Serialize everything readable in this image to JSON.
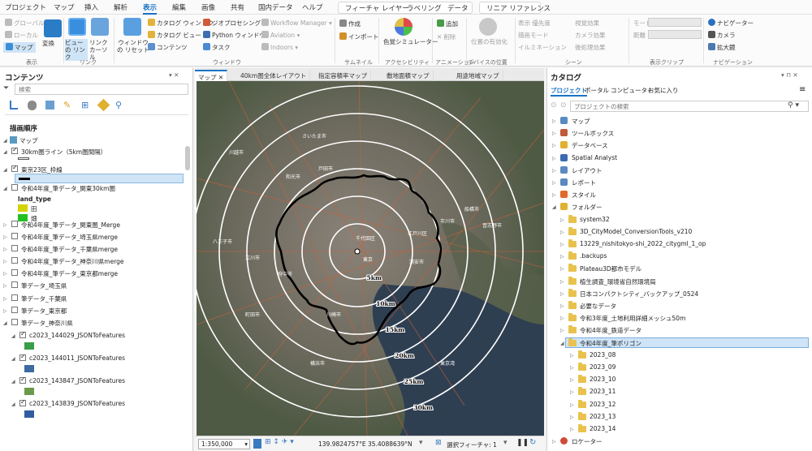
{
  "menu": {
    "tabs": [
      "プロジェクト",
      "マップ",
      "挿入",
      "解析",
      "表示",
      "編集",
      "画像",
      "共有",
      "国内データ",
      "ヘルプ"
    ],
    "active_index": 4,
    "context_tabs": [
      "フィーチャ レイヤー",
      "ラベリング",
      "データ"
    ],
    "context_tab2": "リニア リファレンス"
  },
  "ribbon": {
    "link_group": {
      "items": [
        "グローバル",
        "ローカル",
        "マップ"
      ],
      "label": "表示"
    },
    "change": "変換",
    "link": {
      "items": [
        "ビューの リンク",
        "リンク カーソル"
      ],
      "label": "リンク"
    },
    "window_reset": "ウィンドウの リセット",
    "window_items": [
      "カタログ ウィンドウ",
      "カタログ ビュー",
      "コンテンツ",
      "ジオプロセシング",
      "Python ウィンドウ",
      "タスク",
      "Workflow Manager",
      "Aviation",
      "Indoors"
    ],
    "window_label": "ウィンドウ",
    "thumbnail": {
      "items": [
        "作成",
        "インポート"
      ],
      "label": "サムネイル"
    },
    "accessibility": {
      "item": "色覚シミュレーター",
      "label": "アクセシビリティ"
    },
    "animation": {
      "items": [
        "追加",
        "削除"
      ],
      "label": "アニメーション"
    },
    "device": {
      "item": "位置の有効化",
      "label": "デバイスの位置"
    },
    "scene": {
      "items": [
        "表示 優先度",
        "描画モード",
        "イルミネーション",
        "視覚効果",
        "カメラ効果",
        "後処理効果"
      ],
      "label": "シーン"
    },
    "clip": {
      "items": [
        "モード",
        "距離"
      ],
      "label": "表示クリップ"
    },
    "navigation": {
      "items": [
        "ナビゲーター",
        "カメラ",
        "拡大鏡"
      ],
      "label": "ナビゲーション"
    }
  },
  "contents": {
    "title": "コンテンツ",
    "search_placeholder": "検索",
    "order_label": "描画順序",
    "map_root": "マップ",
    "layers": [
      {
        "label": "30km圏ライン（5km圏間隔）",
        "checked": true,
        "expanded": true
      },
      {
        "label": "東京23区_枠線",
        "checked": true,
        "expanded": true
      },
      {
        "label": "令和4年度_筆データ_関東30km圏",
        "checked": false,
        "expanded": true
      },
      {
        "label": "令和4年度_筆データ_関東圏_Merge",
        "checked": false,
        "expanded": false
      },
      {
        "label": "令和4年度_筆データ_埼玉県merge",
        "checked": false,
        "expanded": false
      },
      {
        "label": "令和4年度_筆データ_千葉県merge",
        "checked": false,
        "expanded": false
      },
      {
        "label": "令和4年度_筆データ_神奈川県merge",
        "checked": false,
        "expanded": false
      },
      {
        "label": "令和4年度_筆データ_東京都merge",
        "checked": false,
        "expanded": false
      },
      {
        "label": "筆データ_埼玉県",
        "checked": false,
        "expanded": false
      },
      {
        "label": "筆データ_千葉県",
        "checked": false,
        "expanded": false
      },
      {
        "label": "筆データ_東京都",
        "checked": false,
        "expanded": false
      },
      {
        "label": "筆データ_神奈川県",
        "checked": false,
        "expanded": true
      },
      {
        "label": "c2023_144029_JSONToFeatures",
        "checked": true,
        "expanded": true
      },
      {
        "label": "c2023_144011_JSONToFeatures",
        "checked": true,
        "expanded": true
      },
      {
        "label": "c2023_143847_JSONToFeatures",
        "checked": true,
        "expanded": true
      },
      {
        "label": "c2023_143839_JSONToFeatures",
        "checked": true,
        "expanded": true
      }
    ],
    "land_type": {
      "field": "land_type",
      "classes": [
        "田",
        "畑"
      ],
      "colors": [
        "#d6d200",
        "#22c022"
      ]
    },
    "swatch_colors": [
      "#3a9e48",
      "#3d6aa0",
      "#6a9a4a",
      "#2f5ea0"
    ]
  },
  "view_tabs": [
    "マップ",
    "40km圏全体レイアウト",
    "指定容積率マップ",
    "敷地面積マップ",
    "用途地域マップ"
  ],
  "map": {
    "ring_labels": [
      "5km",
      "10km",
      "15km",
      "20km",
      "25km",
      "30km"
    ],
    "places": [
      "川越市",
      "さいたま市",
      "戸田市",
      "和光市",
      "東京",
      "千代田区",
      "江戸川区",
      "浦安市",
      "市川市",
      "船橋市",
      "習志野市",
      "横浜市",
      "川崎市",
      "町田市",
      "八王子市",
      "立川市",
      "府中市",
      "東京湾"
    ]
  },
  "status": {
    "scale": "1:350,000",
    "coords": "139.9824757°E 35.4088639°N",
    "selected": "選択フィーチャ: 1"
  },
  "catalog": {
    "title": "カタログ",
    "tabs": [
      "プロジェクト",
      "ポータル",
      "コンピューター",
      "お気に入り"
    ],
    "search_placeholder": "プロジェクトの検索",
    "top": [
      "マップ",
      "ツールボックス",
      "データベース",
      "Spatial Analyst",
      "レイアウト",
      "レポート",
      "スタイル",
      "フォルダー"
    ],
    "folders": [
      "system32",
      "3D_CityModel_ConversionTools_v210",
      "13229_nishitokyo-shi_2022_citygml_1_op",
      ".backups",
      "Plateau3D都市モデル",
      "植生調査_環境省自然環境局",
      "日本コンパクトシティ_バックアップ_0524",
      "必要なデータ",
      "令和3年度_土地利用詳細メッシュ50m",
      "令和4年度_鉄道データ",
      "令和4年度_筆ポリゴン"
    ],
    "subfolders": [
      "2023_08",
      "2023_09",
      "2023_10",
      "2023_11",
      "2023_12",
      "2023_13",
      "2023_14"
    ],
    "bottom": "ロケーター",
    "selected": "令和4年度_筆ポリゴン"
  }
}
